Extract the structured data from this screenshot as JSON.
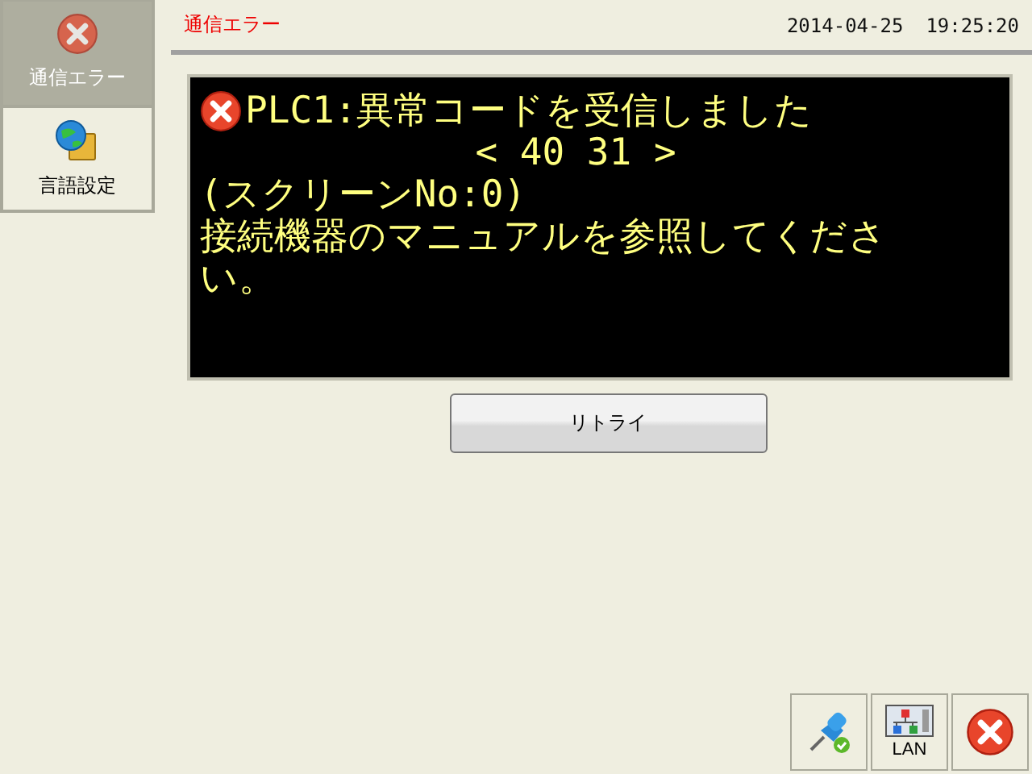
{
  "sidebar": {
    "items": [
      {
        "label": "通信エラー",
        "kind": "error",
        "selected": true
      },
      {
        "label": "言語設定",
        "kind": "globe-book",
        "selected": false
      }
    ]
  },
  "header": {
    "title": "通信エラー",
    "date": "2014-04-25",
    "time": "19:25:20"
  },
  "message": {
    "lines": [
      "PLC1:異常コードを受信しました",
      "< 40 31 >",
      "(スクリーンNo:0)",
      "接続機器のマニュアルを参照してください。"
    ]
  },
  "retry_button": "リトライ",
  "toolbar": [
    {
      "kind": "pin"
    },
    {
      "kind": "lan",
      "label": "LAN"
    },
    {
      "kind": "close"
    }
  ]
}
